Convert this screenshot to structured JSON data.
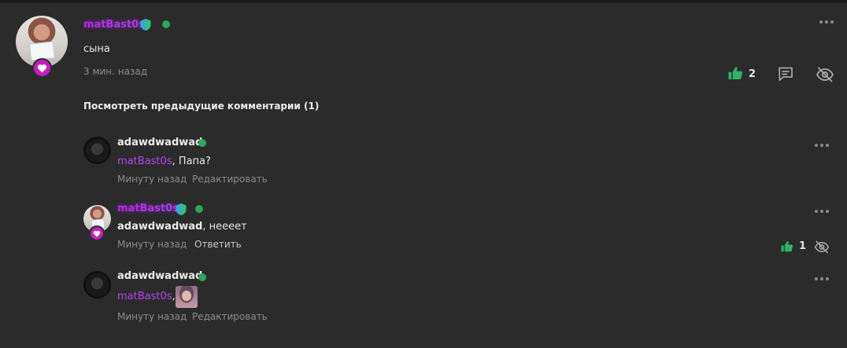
{
  "colors": {
    "background": "#2b2b2b",
    "username_purple": "#c93cf4",
    "online": "#2fa45a",
    "like_green": "#2fb36a",
    "heart_badge": "#c21fbf"
  },
  "main_comment": {
    "author": "matBast0s",
    "text": "сына",
    "time": "3 мин. назад",
    "likes": "2",
    "icons": [
      "shield-icon",
      "like-icon",
      "reply-icon",
      "hide-icon",
      "more-icon"
    ]
  },
  "show_previous": "Посмотреть предыдущие комментарии (1)",
  "replies": [
    {
      "author": "adawdwadwad",
      "mention": "matBast0s",
      "text": ", Папа?",
      "time": "Минуту назад",
      "action": "Редактировать"
    },
    {
      "author": "matBast0s",
      "mention": "adawdwadwad",
      "text": ", неееет",
      "time": "Минуту назад",
      "action": "Ответить",
      "likes": "1"
    },
    {
      "author": "adawdwadwad",
      "mention": "matBast0s",
      "text": ",",
      "time": "Минуту назад",
      "action": "Редактировать"
    }
  ]
}
